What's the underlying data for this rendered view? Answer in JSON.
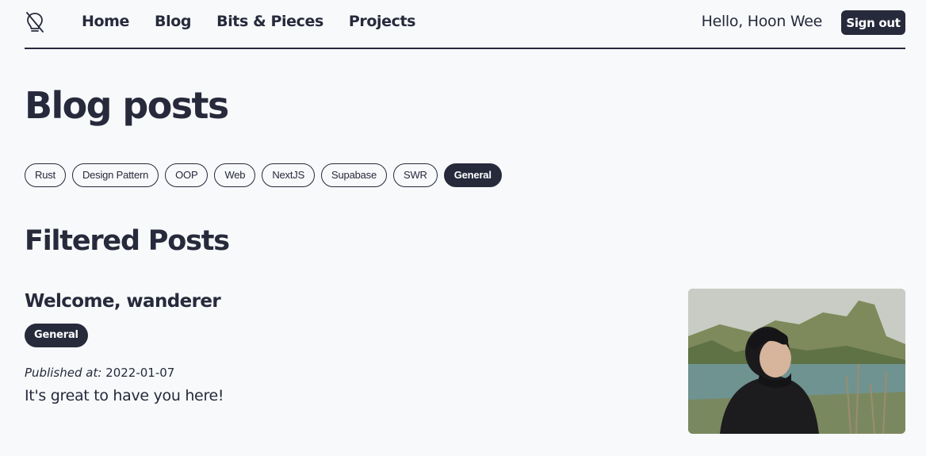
{
  "nav": {
    "logo_icon": "lightbulb-icon",
    "links": [
      "Home",
      "Blog",
      "Bits & Pieces",
      "Projects"
    ],
    "greeting": "Hello, Hoon Wee",
    "signout_label": "Sign out"
  },
  "page": {
    "title": "Blog posts"
  },
  "tags": [
    {
      "label": "Rust",
      "active": false
    },
    {
      "label": "Design Pattern",
      "active": false
    },
    {
      "label": "OOP",
      "active": false
    },
    {
      "label": "Web",
      "active": false
    },
    {
      "label": "NextJS",
      "active": false
    },
    {
      "label": "Supabase",
      "active": false
    },
    {
      "label": "SWR",
      "active": false
    },
    {
      "label": "General",
      "active": true
    }
  ],
  "section": {
    "title": "Filtered Posts"
  },
  "post": {
    "title": "Welcome, wanderer",
    "tag": "General",
    "published_label": "Published at:",
    "published_date": "2022-01-07",
    "excerpt": "It's great to have you here!",
    "image_alt": "photo of person by a lake"
  },
  "colors": {
    "background": "#f8f9fb",
    "ink": "#262a3b"
  }
}
